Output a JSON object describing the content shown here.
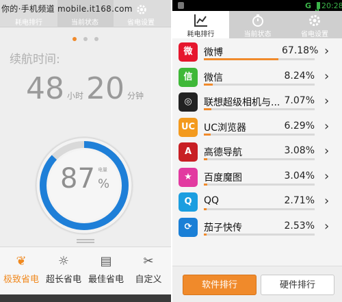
{
  "left_phone": {
    "watermark": "你的·手机频道 mobile.it168.com",
    "tabs": [
      "耗电排行",
      "当前状态",
      "省电设置"
    ],
    "active_tab": 1,
    "endurance_label": "续航时间:",
    "time": {
      "hours": "48",
      "hours_unit": "小时",
      "minutes": "20",
      "minutes_unit": "分钟"
    },
    "battery": {
      "percent": "87",
      "percent_sign": "%",
      "unit_label": "电量",
      "level": 0.87
    },
    "modes": [
      {
        "label": "极致省电",
        "icon": "lightbulb-cluster-icon"
      },
      {
        "label": "超长省电",
        "icon": "lightbulb-icon"
      },
      {
        "label": "最佳省电",
        "icon": "battery-icon"
      },
      {
        "label": "自定义",
        "icon": "tools-icon"
      }
    ],
    "active_mode": 0,
    "colors": {
      "accent": "#f08a2b",
      "gauge": "#1e7fd8"
    }
  },
  "right_phone": {
    "status_time": "20:28",
    "status_network": "G",
    "tabs": [
      "耗电排行",
      "当前状态",
      "省电设置"
    ],
    "active_tab": 0,
    "apps": [
      {
        "name": "微博",
        "percent": "67.18%",
        "share": 0.6718,
        "icon": "weibo-icon",
        "color": "#e6162d",
        "glyph": "微"
      },
      {
        "name": "微信",
        "percent": "8.24%",
        "share": 0.0824,
        "icon": "wechat-icon",
        "color": "#3fb838",
        "glyph": "信"
      },
      {
        "name": "联想超级相机与...",
        "percent": "7.07%",
        "share": 0.0707,
        "icon": "camera-icon",
        "color": "#222222",
        "glyph": "◎"
      },
      {
        "name": "UC浏览器",
        "percent": "6.29%",
        "share": 0.0629,
        "icon": "uc-browser-icon",
        "color": "#f39a1e",
        "glyph": "UC"
      },
      {
        "name": "高德导航",
        "percent": "3.08%",
        "share": 0.0308,
        "icon": "amap-icon",
        "color": "#c81f24",
        "glyph": "A"
      },
      {
        "name": "百度魔图",
        "percent": "3.04%",
        "share": 0.0304,
        "icon": "baidu-motu-icon",
        "color": "#e23aa0",
        "glyph": "★"
      },
      {
        "name": "QQ",
        "percent": "2.71%",
        "share": 0.0271,
        "icon": "qq-icon",
        "color": "#1b9ee0",
        "glyph": "Q"
      },
      {
        "name": "茄子快传",
        "percent": "2.53%",
        "share": 0.0253,
        "icon": "qiezi-share-icon",
        "color": "#1a7fd6",
        "glyph": "⟳"
      }
    ],
    "buttons": {
      "software": "软件排行",
      "hardware": "硬件排行"
    },
    "colors": {
      "accent": "#f08a2b"
    }
  }
}
